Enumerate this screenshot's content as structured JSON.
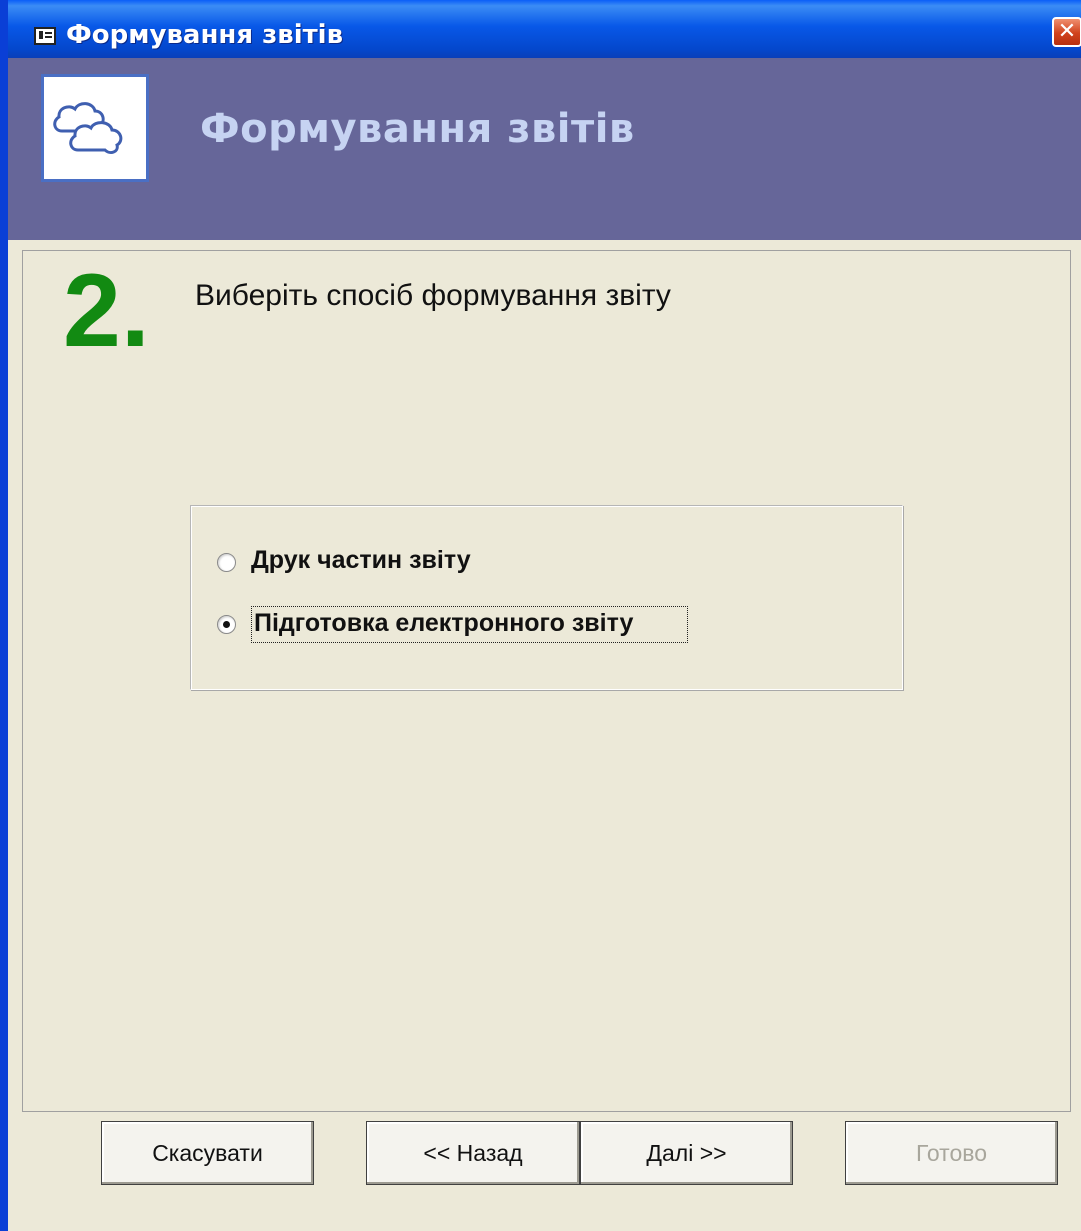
{
  "window": {
    "title": "Формування звітів",
    "close_glyph": "✕"
  },
  "header": {
    "title": "Формування звітів",
    "logo_icon": "clouds-icon"
  },
  "step": {
    "number": "2.",
    "instruction": "Виберіть спосіб формування звіту"
  },
  "options": [
    {
      "label": "Друк частин звіту",
      "selected": false
    },
    {
      "label": "Підготовка електронного звіту",
      "selected": true
    }
  ],
  "buttons": {
    "cancel": "Скасувати",
    "back": "<< Назад",
    "next": "Далі >>",
    "finish": "Готово"
  },
  "colors": {
    "header_band": "#666699",
    "step_number": "#128a12",
    "titlebar": "#0858e8"
  }
}
